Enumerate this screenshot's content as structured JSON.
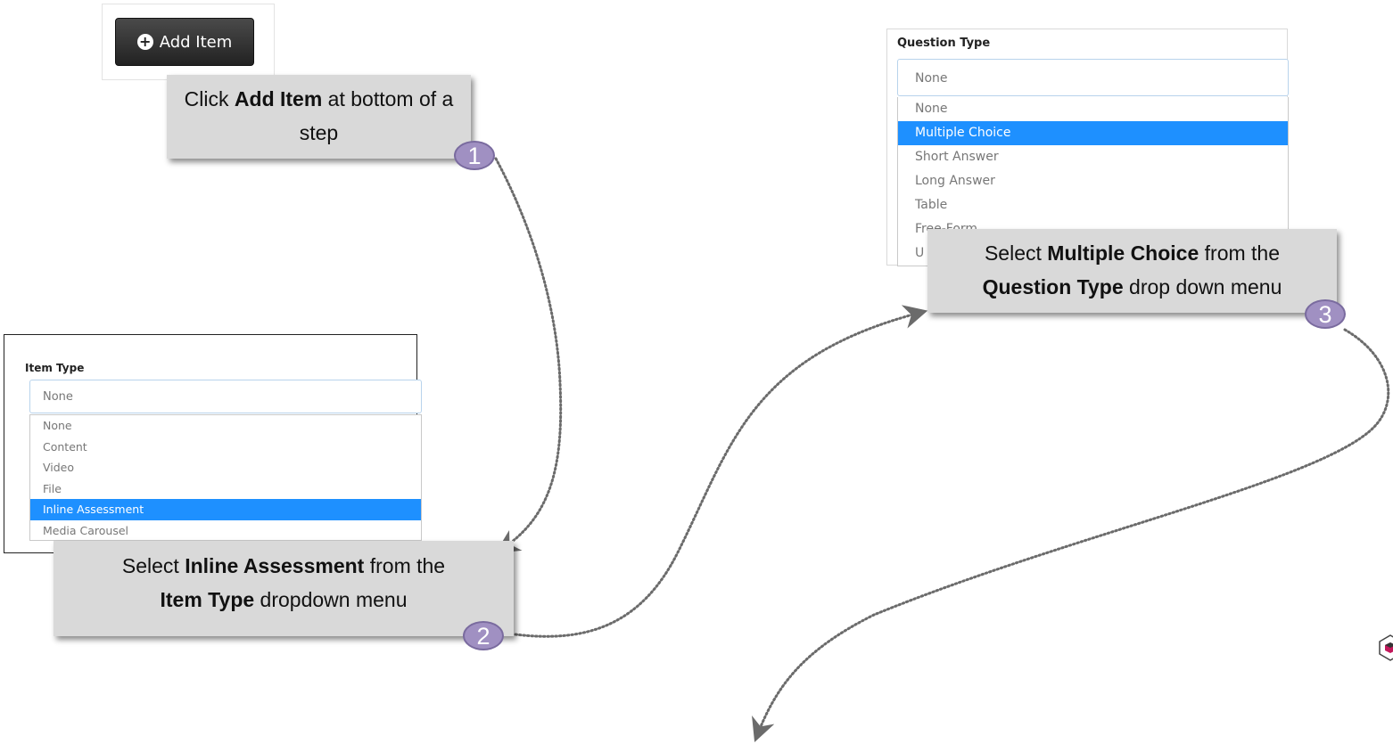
{
  "step1": {
    "button_label": "Add Item",
    "callout_pre": "Click ",
    "callout_bold": "Add Item",
    "callout_post": " at bottom of a step",
    "badge": "1"
  },
  "step2": {
    "field_label": "Item Type",
    "selected_value": "None",
    "options": [
      "None",
      "Content",
      "Video",
      "File",
      "Inline Assessment",
      "Media Carousel"
    ],
    "highlighted_option": "Inline Assessment",
    "callout_pre": "Select ",
    "callout_bold1": "Inline Assessment",
    "callout_mid": " from the ",
    "callout_bold2": "Item Type",
    "callout_post": " dropdown menu",
    "badge": "2"
  },
  "step3": {
    "field_label": "Question Type",
    "selected_value": "None",
    "options": [
      "None",
      "Multiple Choice",
      "Short Answer",
      "Long Answer",
      "Table",
      "Free-Form",
      "U"
    ],
    "highlighted_option": "Multiple Choice",
    "callout_pre": "Select ",
    "callout_bold1": "Multiple Choice",
    "callout_mid": " from the ",
    "callout_bold2": "Question Type",
    "callout_post": " drop down menu",
    "badge": "3"
  },
  "colors": {
    "callout_bg": "#d9d9d9",
    "badge_bg": "#a090c2",
    "highlight": "#1e90ff",
    "arrow": "#6b6b6b"
  }
}
